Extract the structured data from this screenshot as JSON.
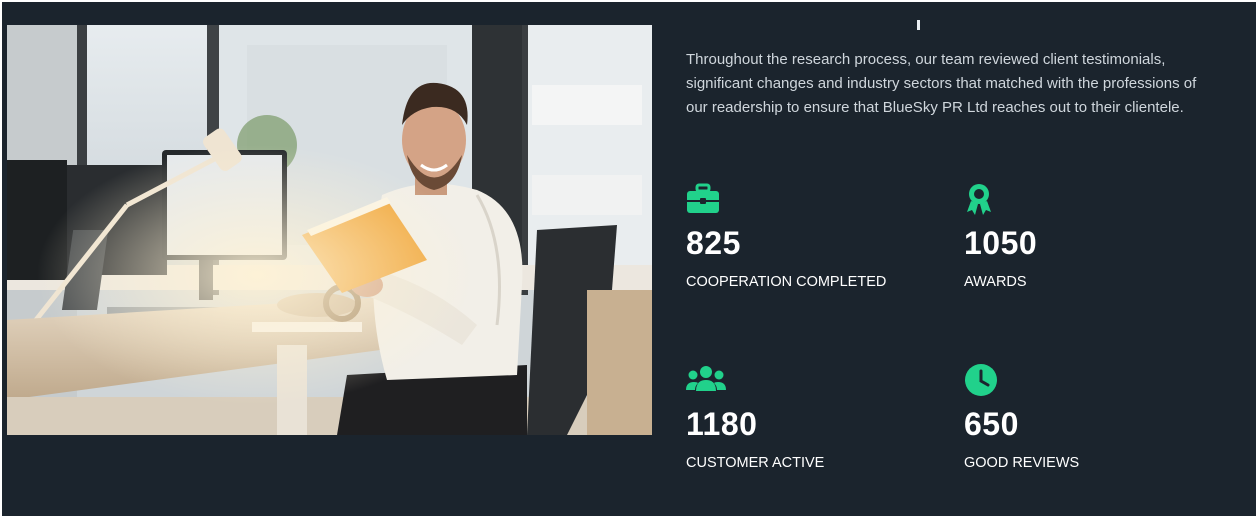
{
  "intro": {
    "text": "Throughout the research process, our team reviewed client testimonials, significant changes and industry sectors that matched with the professions of our readership to ensure that BlueSky PR Ltd reaches out to their clientele."
  },
  "colors": {
    "accent": "#21d18b",
    "background": "#1b242d",
    "text": "#cfd6dc"
  },
  "stats": [
    {
      "icon": "briefcase-icon",
      "value": "825",
      "label": "COOPERATION COMPLETED"
    },
    {
      "icon": "award-icon",
      "value": "1050",
      "label": "AWARDS"
    },
    {
      "icon": "users-icon",
      "value": "1180",
      "label": "CUSTOMER ACTIVE"
    },
    {
      "icon": "clock-icon",
      "value": "650",
      "label": "GOOD REVIEWS"
    }
  ]
}
